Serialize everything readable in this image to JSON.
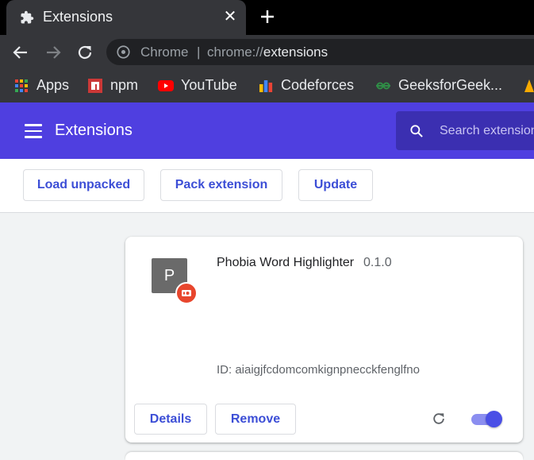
{
  "browser": {
    "tab": {
      "title": "Extensions",
      "icon": "puzzle-icon",
      "close_glyph": "✕"
    },
    "new_tab_icon": "plus-icon",
    "omnibox": {
      "site_chip": "Chrome",
      "separator": "|",
      "url_scheme": "chrome://",
      "url_path": "extensions"
    },
    "bookmarks": [
      {
        "label": "Apps",
        "icon": "apps-grid-icon"
      },
      {
        "label": "npm",
        "icon": "npm-icon"
      },
      {
        "label": "YouTube",
        "icon": "youtube-icon"
      },
      {
        "label": "Codeforces",
        "icon": "codeforces-icon"
      },
      {
        "label": "GeeksforGeek...",
        "icon": "geeksforgeeks-icon"
      }
    ]
  },
  "header": {
    "title": "Extensions",
    "search_placeholder": "Search extensions"
  },
  "dev_toolbar": {
    "load_unpacked": "Load unpacked",
    "pack_extension": "Pack extension",
    "update": "Update"
  },
  "extension": {
    "icon_letter": "P",
    "name": "Phobia Word Highlighter",
    "version": "0.1.0",
    "id_text": "ID: aiaigjfcdomcomkignpnecckfenglfno",
    "details_label": "Details",
    "remove_label": "Remove",
    "enabled": true
  },
  "colors": {
    "header_bg": "#4f3fe0",
    "accent": "#3c4ed6",
    "badge": "#e8462d",
    "tab_strip": "#000000",
    "toolbar": "#35363a"
  }
}
